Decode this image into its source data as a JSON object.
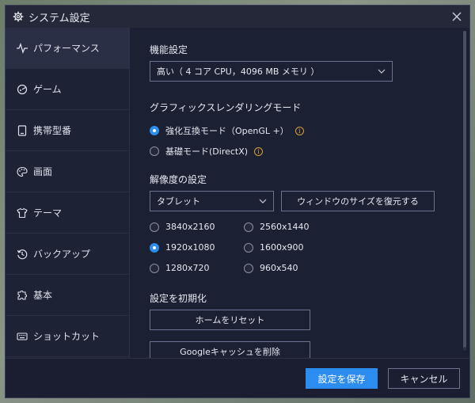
{
  "window": {
    "title": "システム設定"
  },
  "sidebar": {
    "items": [
      {
        "label": "パフォーマンス",
        "icon": "pulse-icon",
        "active": true
      },
      {
        "label": "ゲーム",
        "icon": "game-icon",
        "active": false
      },
      {
        "label": "携帯型番",
        "icon": "phone-icon",
        "active": false
      },
      {
        "label": "画面",
        "icon": "palette-icon",
        "active": false
      },
      {
        "label": "テーマ",
        "icon": "shirt-icon",
        "active": false
      },
      {
        "label": "バックアップ",
        "icon": "restore-icon",
        "active": false
      },
      {
        "label": "基本",
        "icon": "puzzle-icon",
        "active": false
      },
      {
        "label": "ショットカット",
        "icon": "keyboard-icon",
        "active": false
      }
    ]
  },
  "performance": {
    "title": "機能設定",
    "selected": "高い（ 4 コア CPU，4096 MB メモリ ）"
  },
  "rendering": {
    "title": "グラフィックスレンダリングモード",
    "options": [
      {
        "label": "強化互換モード（OpenGL +）",
        "selected": true
      },
      {
        "label": "基礎モード(DirectX)",
        "selected": false
      }
    ]
  },
  "resolution": {
    "title": "解像度の設定",
    "device": "タブレット",
    "restore_label": "ウィンドウのサイズを復元する",
    "options": [
      {
        "label": "3840x2160",
        "selected": false
      },
      {
        "label": "2560x1440",
        "selected": false
      },
      {
        "label": "1920x1080",
        "selected": true
      },
      {
        "label": "1600x900",
        "selected": false
      },
      {
        "label": "1280x720",
        "selected": false
      },
      {
        "label": "960x540",
        "selected": false
      }
    ]
  },
  "reset": {
    "title": "設定を初期化",
    "home_label": "ホームをリセット",
    "cache_label": "Googleキャッシュを削除"
  },
  "footer": {
    "save_label": "設定を保存",
    "cancel_label": "キャンセル"
  },
  "colors": {
    "accent": "#2d8cf0",
    "background": "#1c2033",
    "warning": "#d4a13a"
  }
}
